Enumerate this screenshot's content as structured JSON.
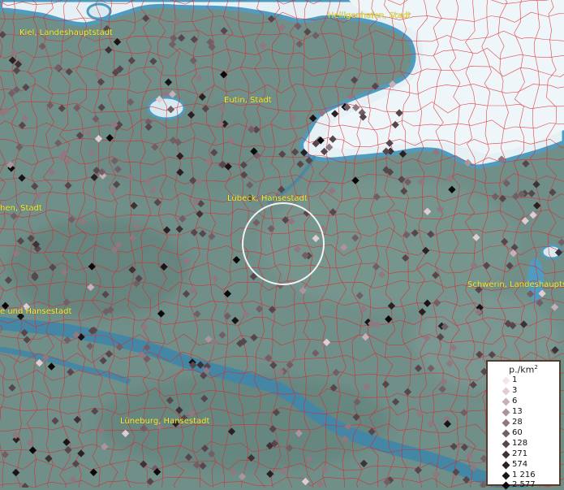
{
  "map": {
    "labels": [
      {
        "id": "heiligenhafen",
        "text": "Heiligenhafen, Stadt"
      },
      {
        "id": "kiel",
        "text": "Kiel, Landeshauptstadt"
      },
      {
        "id": "eutin",
        "text": "Eutin, Stadt"
      },
      {
        "id": "luebeck",
        "text": "Lübeck, Hansestadt"
      },
      {
        "id": "neumuenster",
        "text": "hen, Stadt"
      },
      {
        "id": "schwerin",
        "text": "Schwerin, Landeshaupts"
      },
      {
        "id": "hamburg",
        "text": "e und Hansestadt"
      },
      {
        "id": "lueneburg",
        "text": "Lüneburg, Hansestadt"
      }
    ],
    "colors": {
      "land": "#6f8f88",
      "water_sea": "#e6f1f5",
      "water_river": "#3f86a8",
      "borders": "#e0242a",
      "highlight_ring": "#ffffff"
    }
  },
  "legend": {
    "title": "p./km",
    "title_sup": "2",
    "entries": [
      {
        "label": "1",
        "color": "#f3e6ea"
      },
      {
        "label": "3",
        "color": "#e0cdd3"
      },
      {
        "label": "6",
        "color": "#c9b0b8"
      },
      {
        "label": "13",
        "color": "#ad949c"
      },
      {
        "label": "28",
        "color": "#8f7880"
      },
      {
        "label": "60",
        "color": "#725f65"
      },
      {
        "label": "128",
        "color": "#57474c"
      },
      {
        "label": "271",
        "color": "#3e3236"
      },
      {
        "label": "574",
        "color": "#2a2124"
      },
      {
        "label": "1 216",
        "color": "#1a1416"
      },
      {
        "label": "2 577",
        "color": "#0a0809"
      }
    ]
  }
}
